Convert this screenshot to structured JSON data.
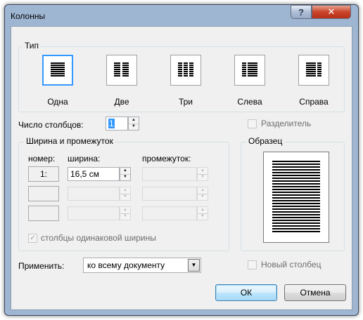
{
  "window": {
    "title": "Колонны",
    "help_label": "?",
    "close_label": "✕"
  },
  "type_group": {
    "label": "Тип",
    "presets": [
      {
        "label": "Одна",
        "selected": true
      },
      {
        "label": "Две",
        "selected": false
      },
      {
        "label": "Три",
        "selected": false
      },
      {
        "label": "Слева",
        "selected": false
      },
      {
        "label": "Справа",
        "selected": false
      }
    ]
  },
  "columns_count": {
    "label": "Число столбцов:",
    "value": "1"
  },
  "separator": {
    "label": "Разделитель",
    "checked": false
  },
  "width_spacing": {
    "label": "Ширина и промежуток",
    "headers": {
      "number": "номер:",
      "width": "ширина:",
      "spacing": "промежуток:"
    },
    "rows": [
      {
        "number": "1:",
        "width": "16,5 см",
        "spacing": ""
      },
      {
        "number": "",
        "width": "",
        "spacing": ""
      },
      {
        "number": "",
        "width": "",
        "spacing": ""
      }
    ],
    "equal_width": {
      "label": "столбцы одинаковой ширины",
      "checked": true
    }
  },
  "sample": {
    "label": "Образец"
  },
  "apply": {
    "label": "Применить:",
    "value": "ко всему документу"
  },
  "new_column": {
    "label": "Новый столбец",
    "checked": false
  },
  "buttons": {
    "ok": "ОК",
    "cancel": "Отмена"
  },
  "colors": {
    "frame": "#9fb6d3",
    "close": "#c9452a",
    "selection": "#3399ff"
  }
}
